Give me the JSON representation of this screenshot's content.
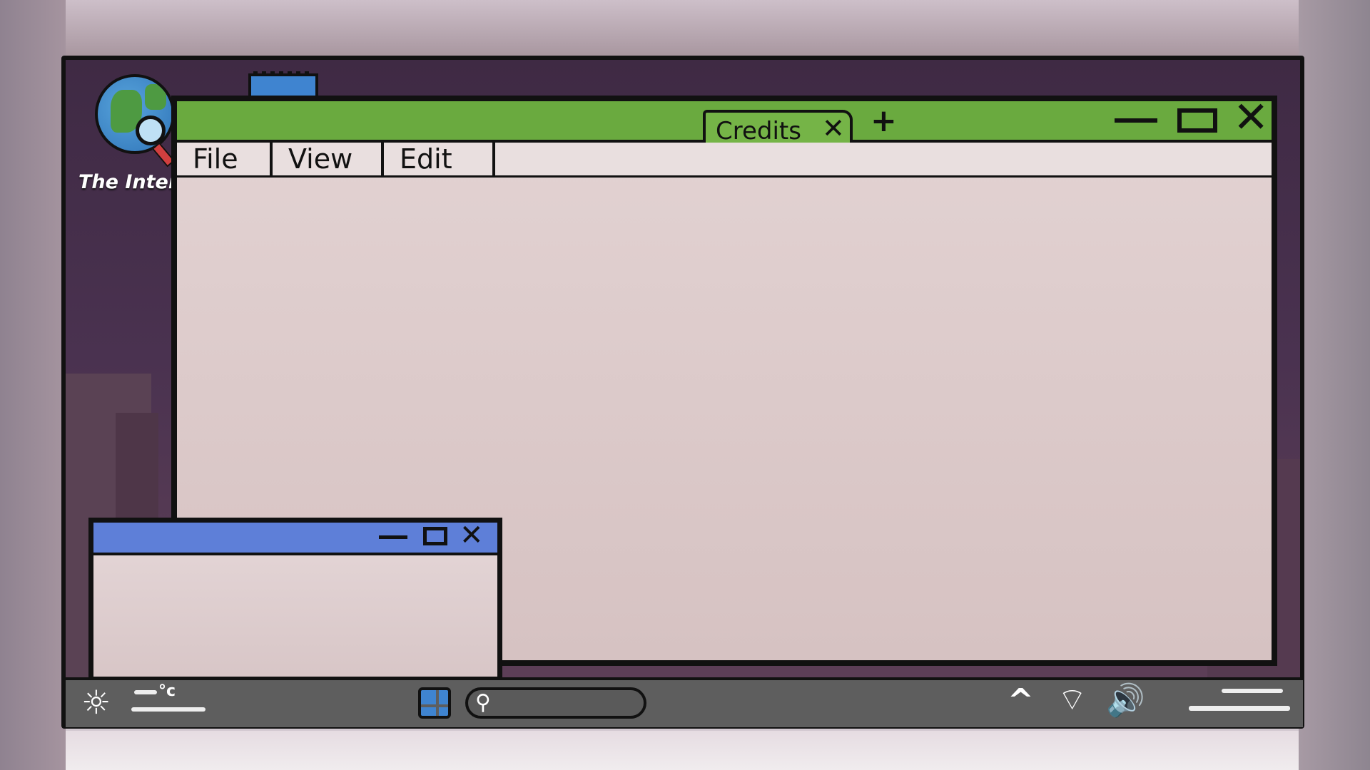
{
  "desktop": {
    "icons": [
      {
        "name": "globe-search-icon",
        "label": "The Inter"
      },
      {
        "name": "notepad-icon",
        "label": ""
      }
    ]
  },
  "main_window": {
    "title_bar_color": "#6aaa3f",
    "tab_label": "Credits",
    "tab_close_glyph": "✕",
    "new_tab_glyph": "+",
    "close_glyph": "✕",
    "menu": [
      "File",
      "View",
      "Edit"
    ]
  },
  "small_window": {
    "title_bar_color": "#5e7fd8",
    "close_glyph": "✕"
  },
  "taskbar": {
    "weather_icon": "sun-icon",
    "weather_glyph": "☼",
    "temperature_unit": "°c",
    "search_glyph": "⚲",
    "search_placeholder": "",
    "tray_chevron": "^",
    "wifi_glyph": "⌔",
    "volume_glyph": "🔊"
  }
}
